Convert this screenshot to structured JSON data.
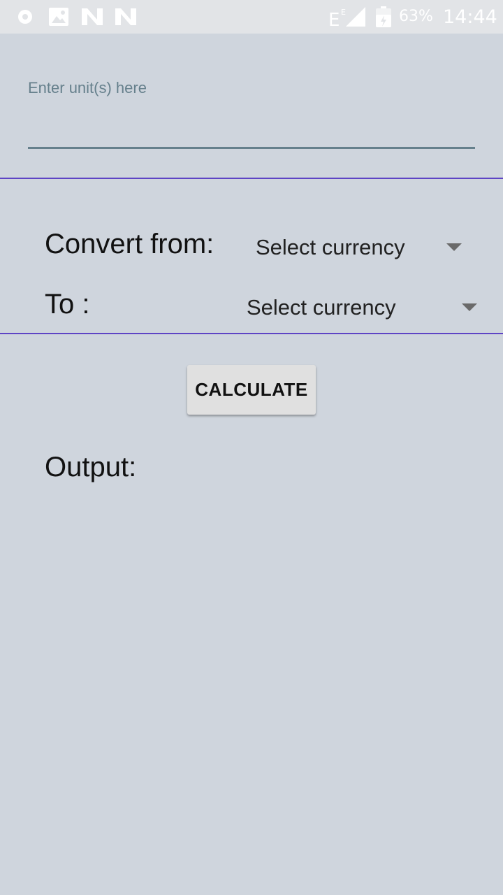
{
  "status_bar": {
    "icons_left": [
      "circle-icon",
      "image-icon",
      "n-icon",
      "n-icon"
    ],
    "icons_right": [
      "network-e-icon",
      "signal-icon",
      "battery-icon"
    ],
    "battery": "63%",
    "time": "14:44"
  },
  "form": {
    "unit_placeholder": "Enter unit(s) here",
    "unit_value": "",
    "convert_from_label": "Convert from:",
    "from_selected": "Select currency",
    "to_label": "To :",
    "to_selected": "Select currency",
    "calculate_label": "CALCULATE",
    "output_label": "Output:",
    "output_value": ""
  },
  "colors": {
    "background": "#cfd5dd",
    "status_bar": "#e2e4e7",
    "accent_divider": "#5e44c5",
    "input_underline": "#66808c",
    "button": "#e0e0e0"
  }
}
